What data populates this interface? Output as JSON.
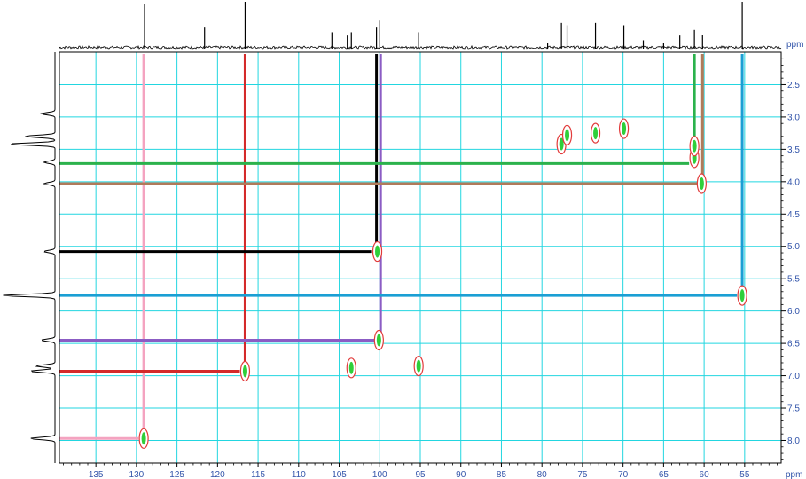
{
  "chart_data": {
    "type": "scatter",
    "subtype": "2D NMR HSQC contour plot with 1D projections",
    "x_axis": {
      "unit_label": "ppm",
      "range": [
        139.5,
        50.5
      ],
      "reversed": true,
      "ticks": [
        135,
        130,
        125,
        120,
        115,
        110,
        105,
        100,
        95,
        90,
        85,
        80,
        75,
        70,
        65,
        60,
        55
      ],
      "tick_labels": [
        "135",
        "130",
        "125",
        "120",
        "115",
        "110",
        "105",
        "100",
        "95",
        "90",
        "85",
        "80",
        "75",
        "70",
        "65",
        "60",
        "55"
      ]
    },
    "y_axis": {
      "unit_label": "ppm",
      "range": [
        2.0,
        8.35
      ],
      "reversed": true,
      "ticks": [
        2.5,
        3.0,
        3.5,
        4.0,
        4.5,
        5.0,
        5.5,
        6.0,
        6.5,
        7.0,
        7.5,
        8.0
      ],
      "tick_labels": [
        "2.5",
        "3.0",
        "3.5",
        "4.0",
        "4.5",
        "5.0",
        "5.5",
        "6.0",
        "6.5",
        "7.0",
        "7.5",
        "8.0"
      ]
    },
    "grid": true,
    "grid_color": "#22d6e0",
    "cross_peaks": [
      {
        "x": 129.1,
        "y": 7.97
      },
      {
        "x": 116.6,
        "y": 6.93
      },
      {
        "x": 103.5,
        "y": 6.88
      },
      {
        "x": 95.2,
        "y": 6.85
      },
      {
        "x": 100.1,
        "y": 6.45
      },
      {
        "x": 100.3,
        "y": 5.08
      },
      {
        "x": 55.3,
        "y": 5.76
      },
      {
        "x": 60.3,
        "y": 4.03
      },
      {
        "x": 61.2,
        "y": 3.63
      },
      {
        "x": 61.2,
        "y": 3.45
      },
      {
        "x": 77.6,
        "y": 3.42
      },
      {
        "x": 76.9,
        "y": 3.28
      },
      {
        "x": 73.4,
        "y": 3.25
      },
      {
        "x": 69.9,
        "y": 3.18
      }
    ],
    "correlation_lines": [
      {
        "color": "#f4a3c0",
        "x": 129.1,
        "y": 7.97
      },
      {
        "color": "#d42a2a",
        "x": 116.6,
        "y": 6.93
      },
      {
        "color": "#8b5cc4",
        "x": 99.9,
        "y": 6.45
      },
      {
        "color": "#000000",
        "x": 100.4,
        "y": 5.08
      },
      {
        "color": "#1a9fd4",
        "x": 55.3,
        "y": 5.76
      },
      {
        "color": "#2bb24c",
        "x": 61.2,
        "y": 3.72
      },
      {
        "color": "#b07a5a",
        "x": 60.2,
        "y": 4.03
      }
    ],
    "top_projection_peaks": [
      {
        "x": 129.0,
        "h": 0.95
      },
      {
        "x": 121.6,
        "h": 0.45
      },
      {
        "x": 116.6,
        "h": 1.0
      },
      {
        "x": 105.9,
        "h": 0.35
      },
      {
        "x": 104.0,
        "h": 0.28
      },
      {
        "x": 103.5,
        "h": 0.35
      },
      {
        "x": 100.4,
        "h": 0.45
      },
      {
        "x": 100.0,
        "h": 0.6
      },
      {
        "x": 95.2,
        "h": 0.35
      },
      {
        "x": 79.3,
        "h": 0.12
      },
      {
        "x": 77.6,
        "h": 0.55
      },
      {
        "x": 76.9,
        "h": 0.5
      },
      {
        "x": 73.4,
        "h": 0.55
      },
      {
        "x": 69.9,
        "h": 0.5
      },
      {
        "x": 67.5,
        "h": 0.18
      },
      {
        "x": 65.0,
        "h": 0.12
      },
      {
        "x": 63.0,
        "h": 0.28
      },
      {
        "x": 61.2,
        "h": 0.4
      },
      {
        "x": 60.2,
        "h": 0.3
      },
      {
        "x": 55.3,
        "h": 1.0
      }
    ],
    "left_projection_peaks": [
      {
        "y": 2.95,
        "h": 0.25
      },
      {
        "y": 3.3,
        "h": 0.55
      },
      {
        "y": 3.42,
        "h": 0.85
      },
      {
        "y": 3.7,
        "h": 0.2
      },
      {
        "y": 4.03,
        "h": 0.2
      },
      {
        "y": 5.08,
        "h": 0.2
      },
      {
        "y": 5.76,
        "h": 0.95
      },
      {
        "y": 6.45,
        "h": 0.25
      },
      {
        "y": 6.85,
        "h": 0.35
      },
      {
        "y": 6.93,
        "h": 0.45
      },
      {
        "y": 7.97,
        "h": 0.45
      }
    ]
  }
}
